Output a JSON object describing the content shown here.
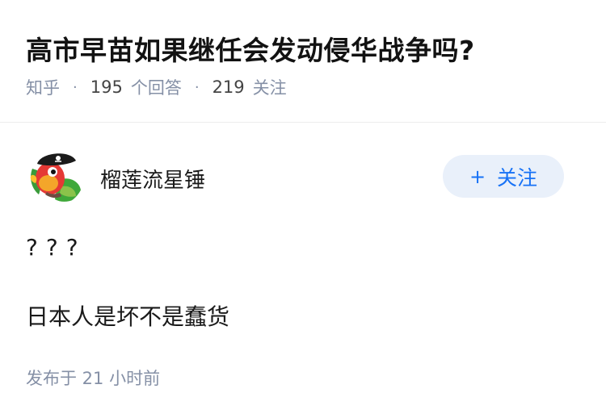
{
  "question": {
    "title": "高市早苗如果继任会发动侵华战争吗?",
    "source": "知乎",
    "separator": "·",
    "answer_count": "195",
    "answer_label": "个回答",
    "follow_count": "219",
    "follow_label": "关注"
  },
  "answer": {
    "author": {
      "name": "榴莲流星锤",
      "avatar_icon": "pirate-parrot-avatar-icon"
    },
    "follow_button": {
      "plus": "+",
      "label": "关注"
    },
    "paragraphs": [
      "???",
      "日本人是坏不是蠢货"
    ],
    "publish_time": "发布于 21 小时前"
  },
  "colors": {
    "accent": "#1772f6",
    "follow_bg": "#e9f0fa",
    "meta": "#8590a6",
    "text": "#1a1a1a"
  }
}
